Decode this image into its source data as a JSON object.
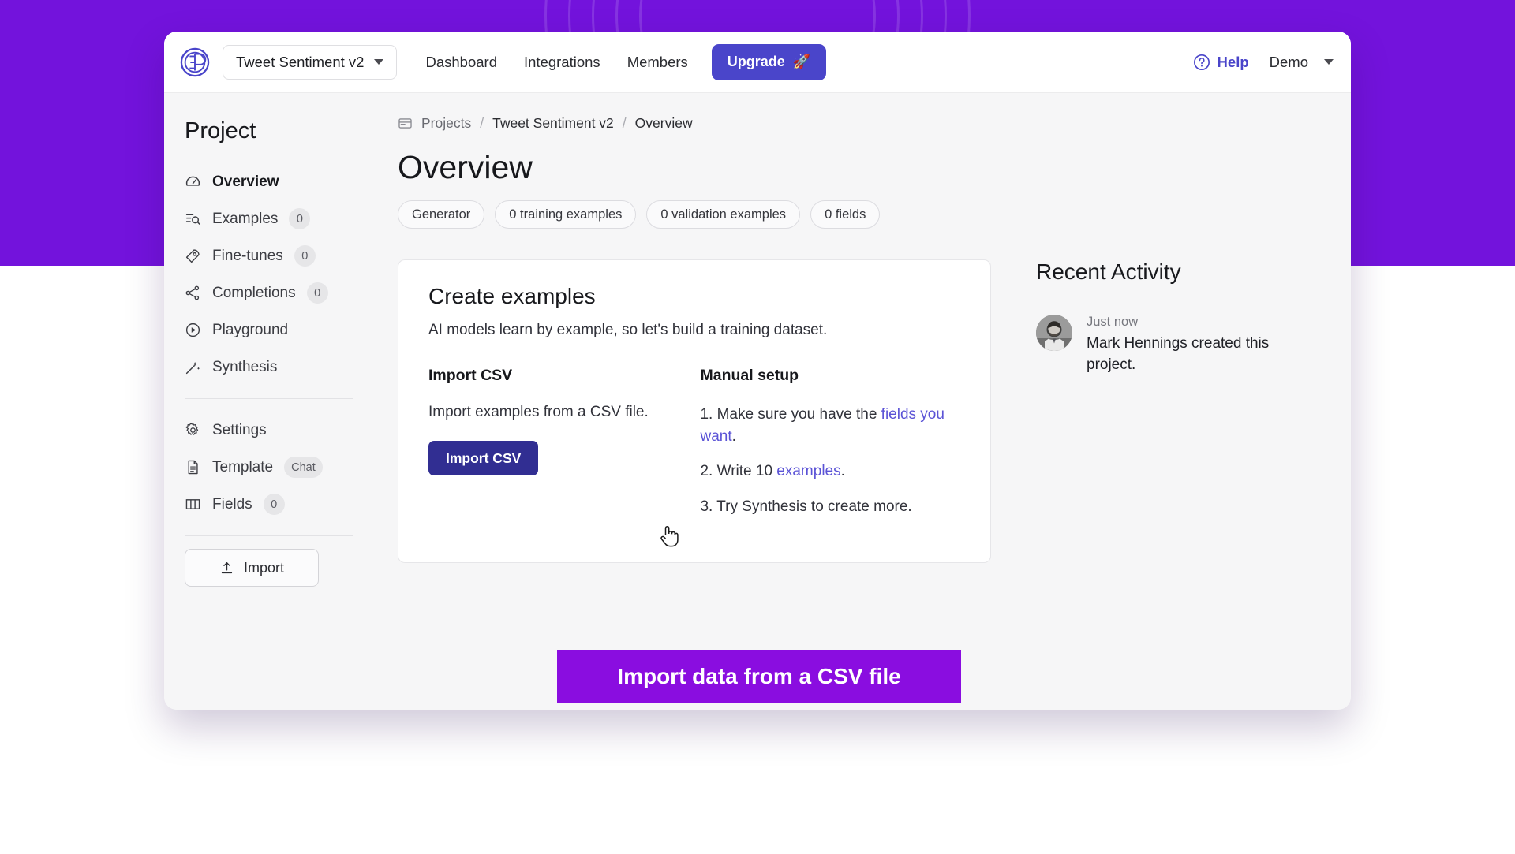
{
  "theme": {
    "backdrop_purple": "#7313DC",
    "accent_indigo": "#4a45ca",
    "deep_indigo": "#312e92",
    "link_indigo": "#5b53d6",
    "banner_purple": "#8A0DE0"
  },
  "topbar": {
    "logo_name": "entry-point-logo",
    "project_select": "Tweet Sentiment v2",
    "nav": [
      {
        "label": "Dashboard"
      },
      {
        "label": "Integrations"
      },
      {
        "label": "Members"
      }
    ],
    "upgrade_label": "Upgrade",
    "upgrade_emoji": "🚀",
    "help_label": "Help",
    "account_label": "Demo"
  },
  "sidebar": {
    "title": "Project",
    "items": [
      {
        "label": "Overview",
        "icon": "speedometer-icon",
        "badge": null,
        "active": true
      },
      {
        "label": "Examples",
        "icon": "list-search-icon",
        "badge": "0",
        "active": false
      },
      {
        "label": "Fine-tunes",
        "icon": "rocket-icon",
        "badge": "0",
        "active": false
      },
      {
        "label": "Completions",
        "icon": "share-nodes-icon",
        "badge": "0",
        "active": false
      },
      {
        "label": "Playground",
        "icon": "play-circle-icon",
        "badge": null,
        "active": false
      },
      {
        "label": "Synthesis",
        "icon": "magic-wand-icon",
        "badge": null,
        "active": false
      }
    ],
    "items2": [
      {
        "label": "Settings",
        "icon": "gear-icon",
        "badge": null
      },
      {
        "label": "Template",
        "icon": "document-icon",
        "badge": "Chat"
      },
      {
        "label": "Fields",
        "icon": "columns-icon",
        "badge": "0"
      }
    ],
    "import_label": "Import"
  },
  "breadcrumb": {
    "root": "Projects",
    "project": "Tweet Sentiment v2",
    "current": "Overview",
    "separator": "/"
  },
  "page": {
    "title": "Overview",
    "chips": [
      {
        "label": "Generator"
      },
      {
        "label": "0 training examples"
      },
      {
        "label": "0 validation examples"
      },
      {
        "label": "0 fields"
      }
    ]
  },
  "card": {
    "heading": "Create examples",
    "lede": "AI models learn by example, so let's build a training dataset.",
    "import": {
      "heading": "Import CSV",
      "text": "Import examples from a CSV file.",
      "button_label": "Import CSV"
    },
    "manual": {
      "heading": "Manual setup",
      "step1_pre": "1. Make sure you have the ",
      "step1_link": "fields you want",
      "step1_post": ".",
      "step2_pre": "2. Write 10 ",
      "step2_link": "examples",
      "step2_post": ".",
      "step3": "3. Try Synthesis to create more."
    }
  },
  "activity": {
    "heading": "Recent Activity",
    "items": [
      {
        "time": "Just now",
        "text": "Mark Hennings created this project."
      }
    ]
  },
  "banner": {
    "caption": "Import data from a CSV file"
  }
}
